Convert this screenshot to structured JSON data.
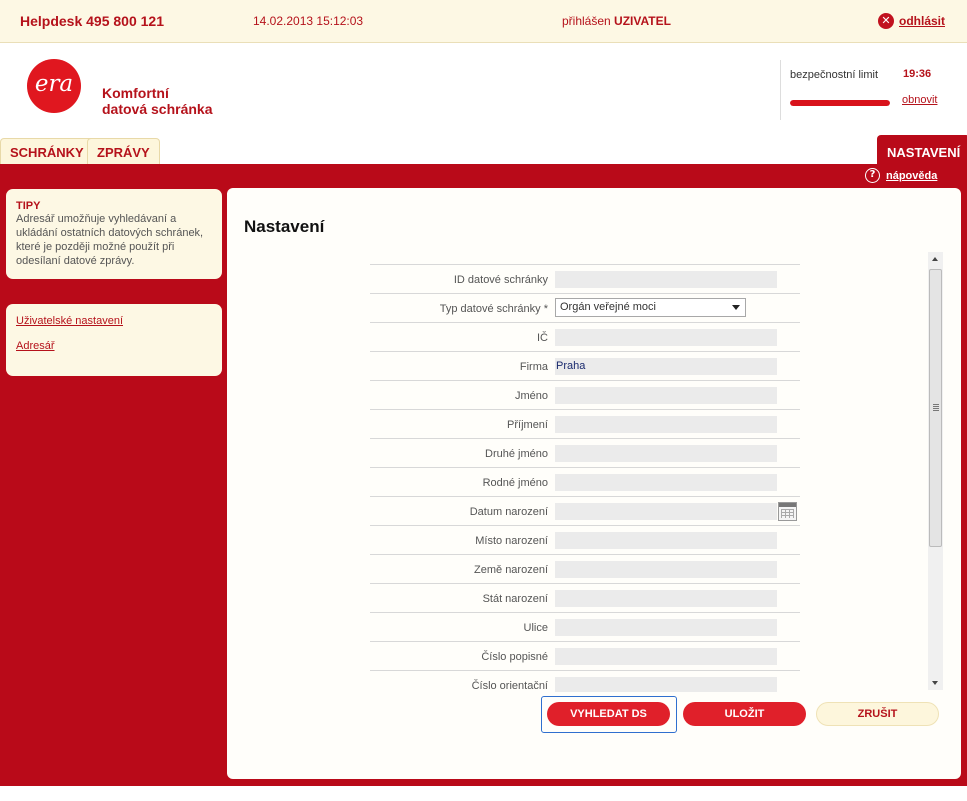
{
  "topbar": {
    "helpdesk": "Helpdesk 495 800 121",
    "datetime": "14.02.2013 15:12:03",
    "logged_prefix": "přihlášen",
    "user": "UZIVATEL",
    "logout": "odhlásit"
  },
  "brand": {
    "logo_text": "era",
    "line1": "Komfortní",
    "line2": "datová schránka"
  },
  "security": {
    "label": "bezpečnostní limit",
    "time": "19:36",
    "renew": "obnovit",
    "progress": 1.0
  },
  "tabs": [
    {
      "label": "SCHRÁNKY",
      "active": false
    },
    {
      "label": "ZPRÁVY",
      "active": false
    },
    {
      "label": "NASTAVENÍ",
      "active": true
    }
  ],
  "help_label": "nápověda",
  "tips": {
    "title": "TIPY",
    "text": "Adresář umožňuje vyhledávaní a ukládání ostatních datových schránek, které je později možné použít při odesílaní datové zprávy."
  },
  "sidebar_links": [
    "Uživatelské nastavení",
    "Adresář"
  ],
  "page_title": "Nastavení",
  "form": {
    "fields": [
      {
        "label": "ID datové schránky",
        "value": ""
      },
      {
        "label": "Typ datové schránky *",
        "value": "Orgán veřejné moci"
      },
      {
        "label": "IČ",
        "value": ""
      },
      {
        "label": "Firma",
        "value": "Praha"
      },
      {
        "label": "Jméno",
        "value": ""
      },
      {
        "label": "Příjmení",
        "value": ""
      },
      {
        "label": "Druhé jméno",
        "value": ""
      },
      {
        "label": "Rodné jméno",
        "value": ""
      },
      {
        "label": "Datum narození",
        "value": ""
      },
      {
        "label": "Místo narození",
        "value": ""
      },
      {
        "label": "Země narození",
        "value": ""
      },
      {
        "label": "Stát narození",
        "value": ""
      },
      {
        "label": "Ulice",
        "value": ""
      },
      {
        "label": "Číslo popisné",
        "value": ""
      },
      {
        "label": "Číslo orientační",
        "value": ""
      }
    ]
  },
  "buttons": {
    "search": "VYHLEDAT DS",
    "save": "ULOŽIT",
    "cancel": "ZRUŠIT"
  },
  "colors": {
    "brand_red": "#b90a19",
    "button_red": "#e0202a",
    "cream": "#fdf8e4"
  }
}
